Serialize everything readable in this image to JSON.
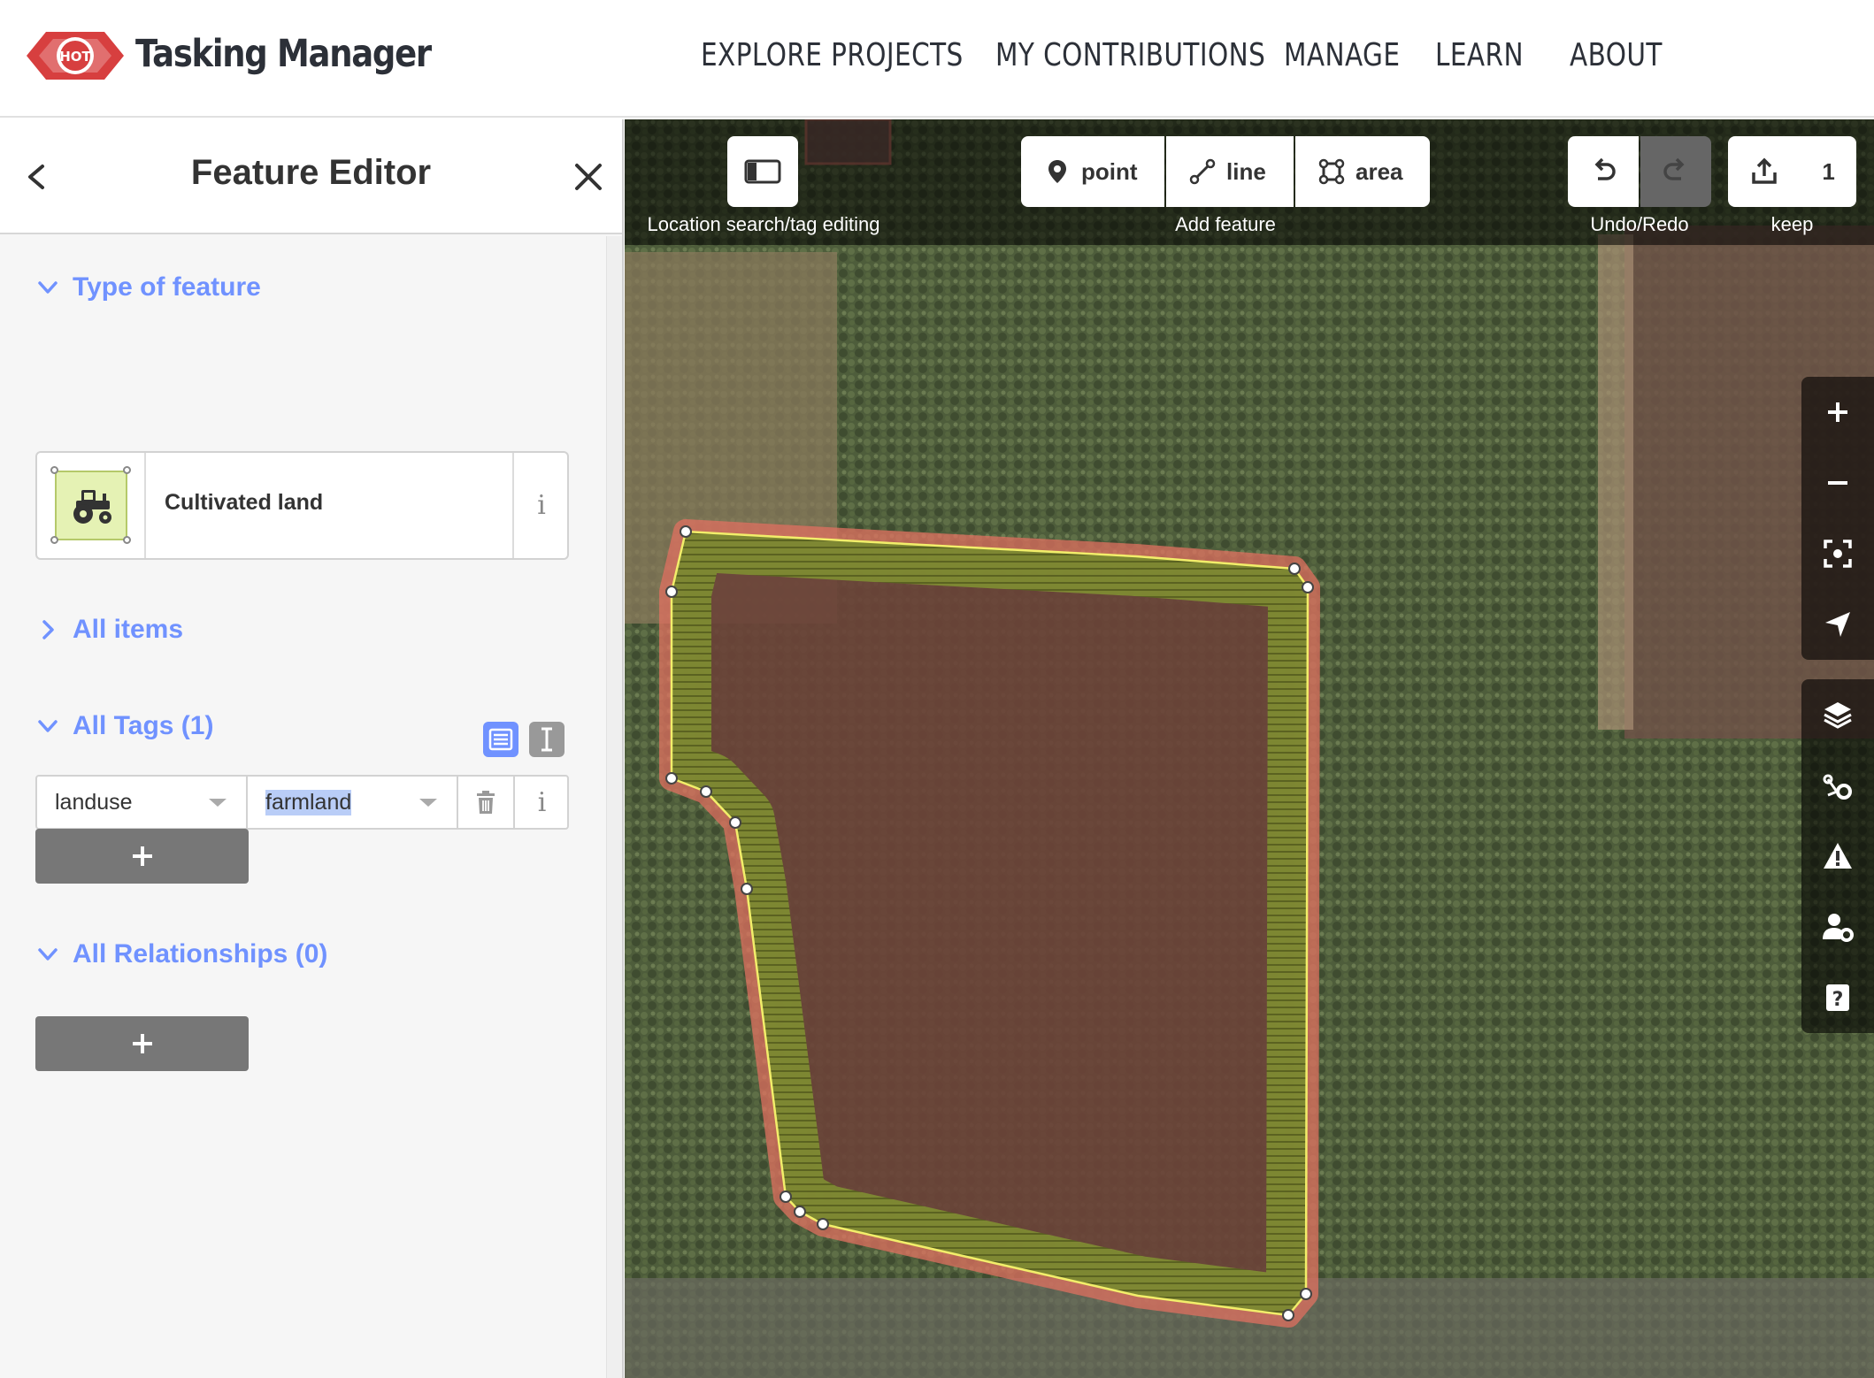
{
  "header": {
    "logo_text": "HOT",
    "brand": "Tasking Manager",
    "nav": [
      "EXPLORE PROJECTS",
      "MY CONTRIBUTIONS",
      "MANAGE",
      "LEARN",
      "ABOUT"
    ]
  },
  "sidebar": {
    "title": "Feature Editor",
    "type_section": "Type of feature",
    "preset_label": "Cultivated land",
    "preset_icon": "tractor-icon",
    "info_glyph": "i",
    "all_items": "All items",
    "tags_section": "All Tags (1)",
    "tag": {
      "key": "landuse",
      "value": "farmland"
    },
    "relations_section": "All Relationships (0)",
    "accent": "#7092ff"
  },
  "map": {
    "sidebar_toggle_label": "Location search/tag editing",
    "add_feature_label": "Add feature",
    "modes": [
      "point",
      "line",
      "area"
    ],
    "undo_redo_label": "Undo/Redo",
    "save_count": "1",
    "save_label": "keep",
    "controls": [
      "zoom-in-icon",
      "zoom-out-icon",
      "zoom-to-selection-icon",
      "geolocate-icon",
      "layers-icon",
      "map-data-icon",
      "issues-icon",
      "preferences-icon",
      "help-icon"
    ],
    "area_outline_color": "#e07060",
    "area_fill_color": "#8a9a30"
  }
}
